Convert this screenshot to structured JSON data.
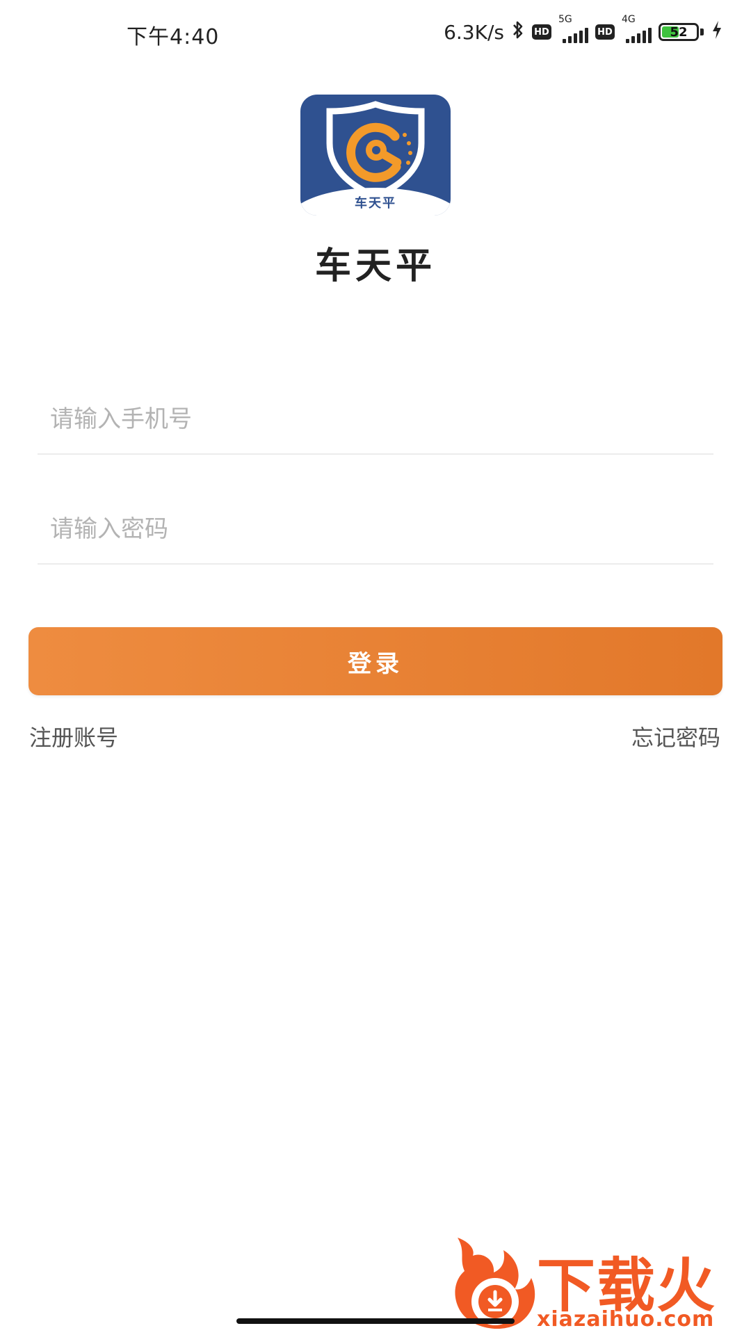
{
  "status_bar": {
    "time": "下午4:40",
    "net_speed": "6.3K/s",
    "sim1_network": "5G",
    "sim2_network": "4G",
    "hd_label": "HD",
    "battery_level": "52",
    "battery_percent": 52
  },
  "app": {
    "logo_text": "车天平",
    "name": "车天平"
  },
  "login_form": {
    "phone_placeholder": "请输入手机号",
    "password_placeholder": "请输入密码",
    "login_label": "登录",
    "register_label": "注册账号",
    "forgot_label": "忘记密码"
  },
  "watermark": {
    "brand": "下载火",
    "url": "xiazaihuo.com"
  },
  "colors": {
    "logo_blue": "#2f5190",
    "logo_orange": "#f39a2a",
    "button_orange_start": "#ee8c40",
    "button_orange_end": "#e2782a",
    "watermark_orange": "#f15a24"
  }
}
